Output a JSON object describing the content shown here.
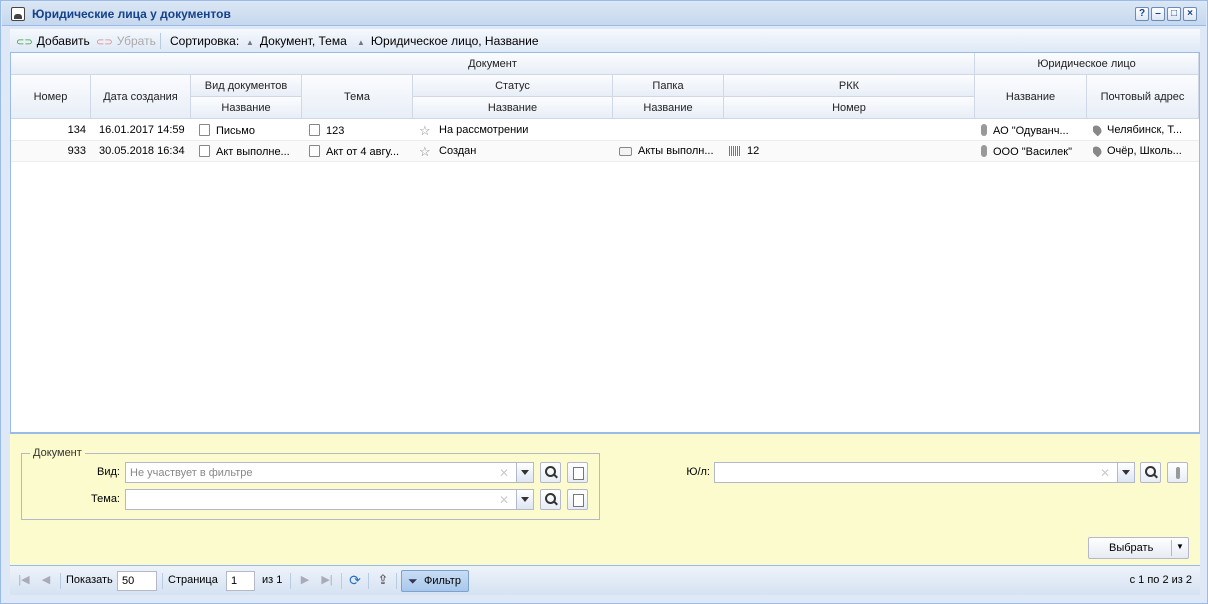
{
  "window": {
    "title": "Юридические лица у документов",
    "controls": [
      "?",
      "–",
      "□",
      "×"
    ]
  },
  "toolbar": {
    "add_label": "Добавить",
    "remove_label": "Убрать",
    "sort_label": "Сортировка:",
    "sort1_label": "Документ, Тема",
    "sort2_label": "Юридическое лицо, Название"
  },
  "grid": {
    "groups": {
      "document": "Документ",
      "legal_entity": "Юридическое лицо"
    },
    "headers": {
      "number": "Номер",
      "created": "Дата создания",
      "doc_type": "Вид документов",
      "doc_type_name": "Название",
      "topic": "Тема",
      "status": "Статус",
      "status_name": "Название",
      "folder": "Папка",
      "folder_name": "Название",
      "rkk": "РКК",
      "rkk_number": "Номер",
      "le_name": "Название",
      "postal_address": "Почтовый адрес"
    },
    "rows": [
      {
        "number": "134",
        "created": "16.01.2017 14:59",
        "doc_type": "Письмо",
        "topic": "123",
        "status": "На рассмотрении",
        "folder": "",
        "rkk": "",
        "le_name": "АО \"Одуванч...",
        "address": "Челябинск, Т..."
      },
      {
        "number": "933",
        "created": "30.05.2018 16:34",
        "doc_type": "Акт выполне...",
        "topic": "Акт от 4 авгу...",
        "status": "Создан",
        "folder": "Акты выполн...",
        "rkk": "12",
        "le_name": "ООО \"Василек\"",
        "address": "Очёр, Школь..."
      }
    ]
  },
  "filter": {
    "legend": "Документ",
    "type_label": "Вид:",
    "type_placeholder": "Не участвует в фильтре",
    "topic_label": "Тема:",
    "topic_value": "",
    "le_label": "Ю/л:",
    "le_value": "",
    "select_label": "Выбрать"
  },
  "pager": {
    "show_label": "Показать",
    "page_size": "50",
    "page_label": "Страница",
    "page": "1",
    "of_label": "из 1",
    "filter_label": "Фильтр",
    "summary": "с 1 по 2 из 2"
  }
}
